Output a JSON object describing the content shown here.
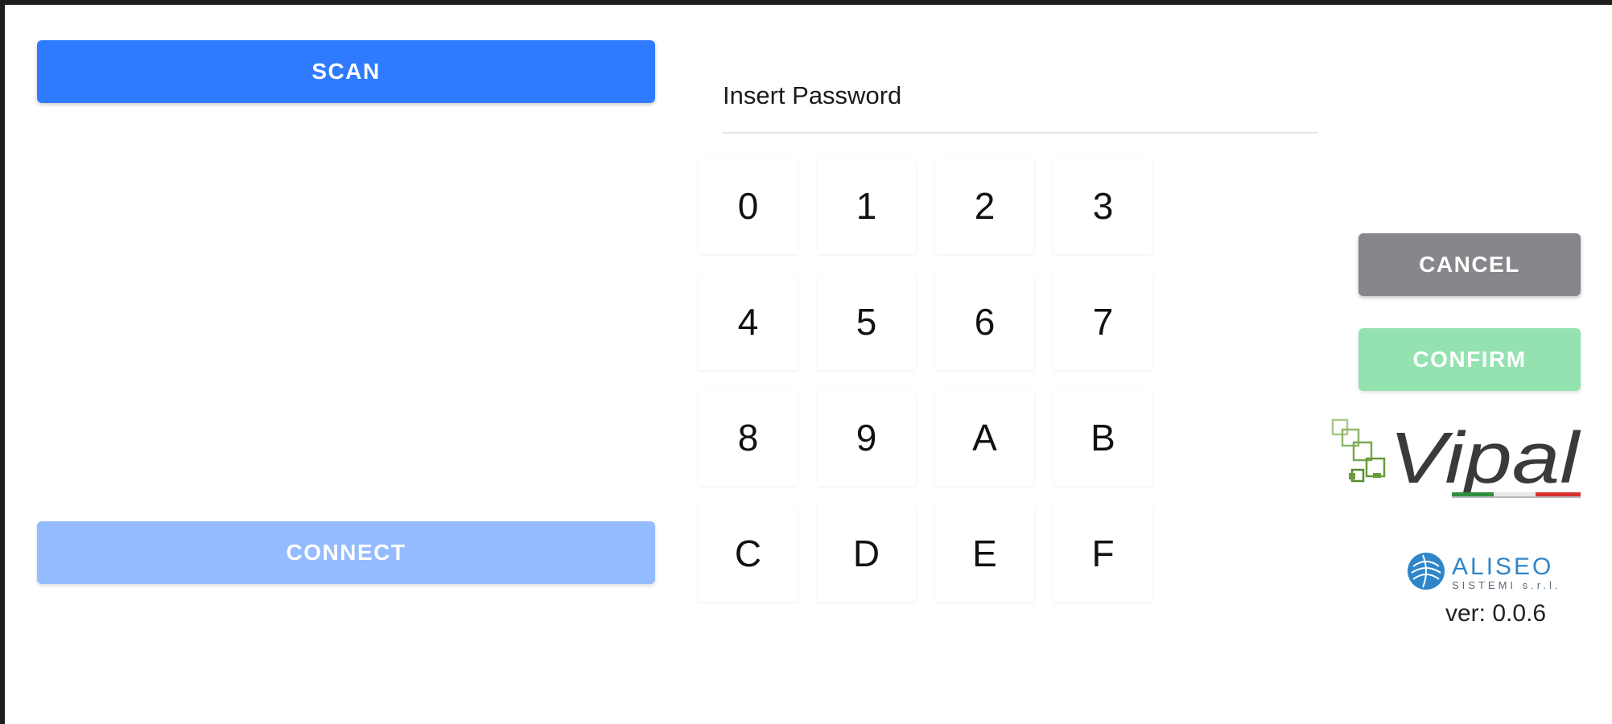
{
  "left_panel": {
    "scan_label": "SCAN",
    "connect_label": "CONNECT"
  },
  "password": {
    "placeholder": "Insert Password",
    "value": ""
  },
  "keypad": {
    "keys": [
      "0",
      "1",
      "2",
      "3",
      "4",
      "5",
      "6",
      "7",
      "8",
      "9",
      "A",
      "B",
      "C",
      "D",
      "E",
      "F"
    ]
  },
  "actions": {
    "cancel_label": "CANCEL",
    "confirm_label": "CONFIRM"
  },
  "branding": {
    "vipal_logo_text": "Vipal",
    "aliseo_name": "ALISEO",
    "aliseo_subtitle": "SISTEMI s.r.l.",
    "version": "ver: 0.0.6"
  },
  "colors": {
    "scan": "#2f7bff",
    "connect_disabled": "#95bbff",
    "cancel": "#85878b",
    "confirm_disabled": "#93e2b0",
    "vipal_green": "#6a9a3a",
    "aliseo_blue": "#2e86c9"
  },
  "icons": {
    "vipal": "vipal-logo-icon",
    "aliseo": "aliseo-logo-icon"
  }
}
